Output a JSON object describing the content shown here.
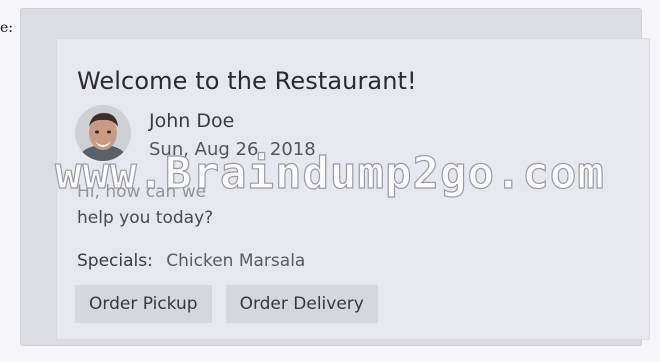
{
  "edge_label": "e:",
  "card": {
    "title": "Welcome to the Restaurant!",
    "user": {
      "name": "John Doe",
      "date": "Sun, Aug 26, 2018"
    },
    "message": {
      "line1": "Hi, how can we",
      "line2": "help you today?"
    },
    "specials": {
      "label": "Specials:",
      "value": "Chicken Marsala"
    },
    "actions": [
      {
        "label": "Order Pickup"
      },
      {
        "label": "Order Delivery"
      }
    ]
  },
  "watermark": "www.Braindump2go.com"
}
